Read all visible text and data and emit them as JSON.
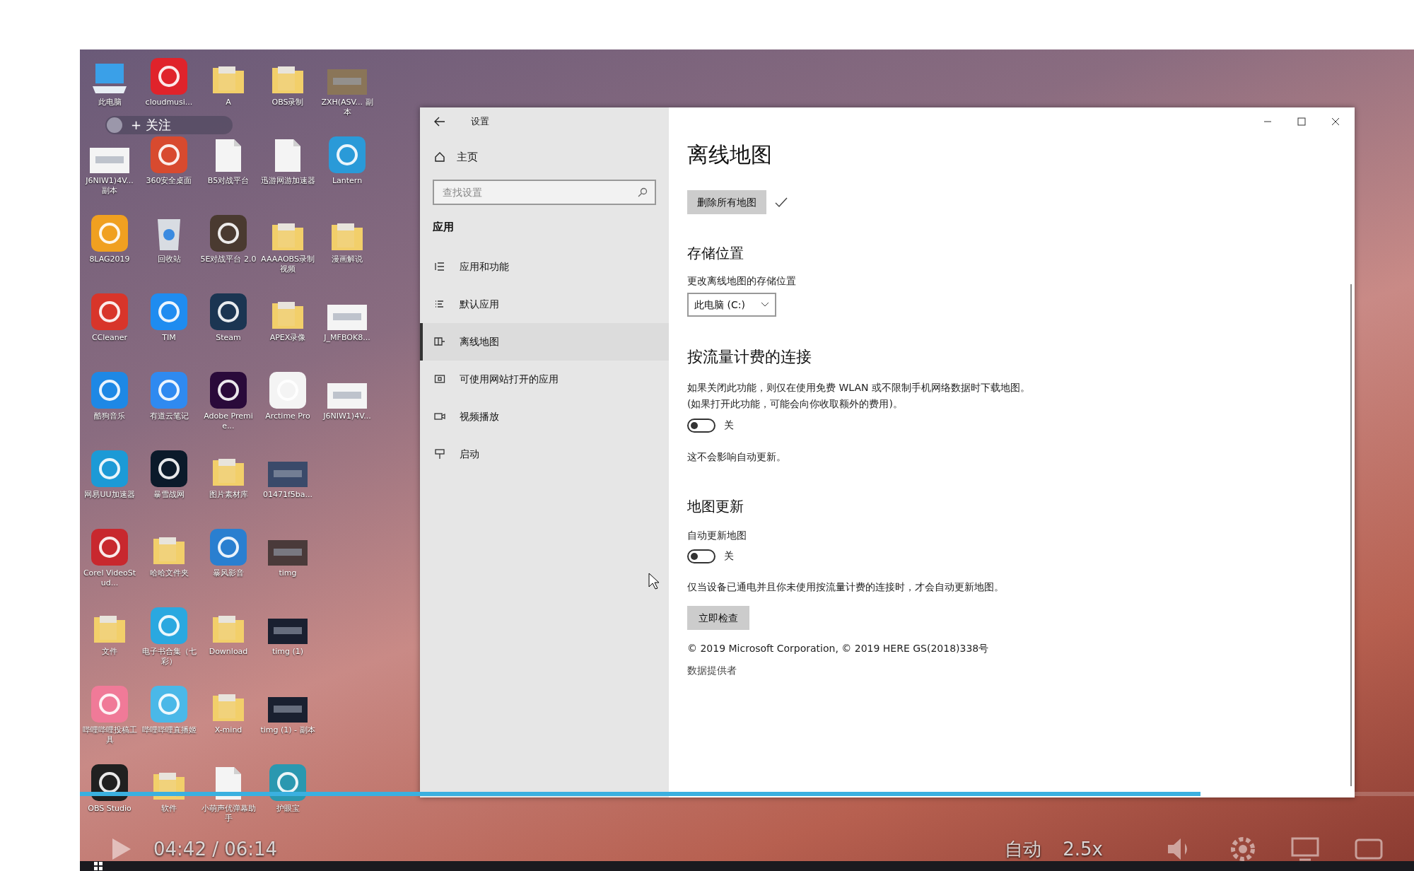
{
  "video_player": {
    "follow_button": "+ 关注",
    "time": "04:42 / 06:14",
    "quality": "自动",
    "speed": "2.5x",
    "progress": {
      "level": 0.84
    }
  },
  "desktop_icons": [
    {
      "label": "此电脑",
      "kind": "pc",
      "color": "#3aa0e8"
    },
    {
      "label": "cloudmusi...",
      "kind": "app",
      "color": "#e0232b"
    },
    {
      "label": "A",
      "kind": "folder",
      "color": "#f2cf6a"
    },
    {
      "label": "OBS录制",
      "kind": "folder",
      "color": "#f2cf6a"
    },
    {
      "label": "ZXH(ASV... 副本",
      "kind": "image",
      "color": "#8a7558"
    },
    {
      "label": "J6NIW1)4V... 副本",
      "kind": "image",
      "color": "#f4f4f4"
    },
    {
      "label": "360安全桌面",
      "kind": "app",
      "color": "#d84a2f"
    },
    {
      "label": "B5对战平台",
      "kind": "file",
      "color": "#f4f4f4"
    },
    {
      "label": "迅游网游加速器",
      "kind": "file",
      "color": "#f4f4f4"
    },
    {
      "label": "Lantern",
      "kind": "app",
      "color": "#2a9ad8"
    },
    {
      "label": "8LAG2019",
      "kind": "app",
      "color": "#f0a020"
    },
    {
      "label": "回收站",
      "kind": "bin",
      "color": "#d8dce2"
    },
    {
      "label": "5E对战平台 2.0",
      "kind": "app",
      "color": "#4a3a30"
    },
    {
      "label": "AAAAOBS录制视频",
      "kind": "folder",
      "color": "#f2cf6a"
    },
    {
      "label": "漫画解说",
      "kind": "folder",
      "color": "#f2cf6a"
    },
    {
      "label": "CCleaner",
      "kind": "app",
      "color": "#d8352a"
    },
    {
      "label": "TIM",
      "kind": "app",
      "color": "#1f8cf0"
    },
    {
      "label": "Steam",
      "kind": "app",
      "color": "#1b3552"
    },
    {
      "label": "APEX录像",
      "kind": "folder",
      "color": "#f2cf6a"
    },
    {
      "label": "J_MFBOK8...",
      "kind": "image",
      "color": "#f4f4f4"
    },
    {
      "label": "酷狗音乐",
      "kind": "app",
      "color": "#1e88e5"
    },
    {
      "label": "有道云笔记",
      "kind": "app",
      "color": "#2f8af0"
    },
    {
      "label": "Adobe Premie...",
      "kind": "app",
      "color": "#2a0a3a"
    },
    {
      "label": "Arctime Pro",
      "kind": "app",
      "color": "#f4f4f4"
    },
    {
      "label": "J6NIW1)4V...",
      "kind": "image",
      "color": "#f4f4f4"
    },
    {
      "label": "网易UU加速器",
      "kind": "app",
      "color": "#1c9ad6"
    },
    {
      "label": "暴雪战网",
      "kind": "app",
      "color": "#0b1a2a"
    },
    {
      "label": "图片素材库",
      "kind": "folder",
      "color": "#f2cf6a"
    },
    {
      "label": "01471f5ba...",
      "kind": "image",
      "color": "#3a4a6a"
    },
    {
      "label": "Corel VideoStud...",
      "kind": "app",
      "color": "#c8282e"
    },
    {
      "label": "哈哈文件夹",
      "kind": "folder",
      "color": "#f2cf6a"
    },
    {
      "label": "暴风影音",
      "kind": "app",
      "color": "#2a7fd0"
    },
    {
      "label": "timg",
      "kind": "image",
      "color": "#4a3a3a"
    },
    {
      "label": "文件",
      "kind": "folder",
      "color": "#f2cf6a"
    },
    {
      "label": "电子书合集（七彩）",
      "kind": "app",
      "color": "#2aa8e0"
    },
    {
      "label": "Download",
      "kind": "folder",
      "color": "#f2cf6a"
    },
    {
      "label": "timg (1)",
      "kind": "image",
      "color": "#1a2030"
    },
    {
      "label": "哔哩哔哩投稿工具",
      "kind": "app",
      "color": "#f07a98"
    },
    {
      "label": "哔哩哔哩直播姬",
      "kind": "app",
      "color": "#4ab8e8"
    },
    {
      "label": "X-mind",
      "kind": "folder",
      "color": "#f2cf6a"
    },
    {
      "label": "timg (1) - 副本",
      "kind": "image",
      "color": "#1a2030"
    },
    {
      "label": "OBS Studio",
      "kind": "app",
      "color": "#202020"
    },
    {
      "label": "软件",
      "kind": "folder",
      "color": "#f2cf6a"
    },
    {
      "label": "小萌声优弹幕助手",
      "kind": "file",
      "color": "#f4f4f4"
    },
    {
      "label": "护眼宝",
      "kind": "app",
      "color": "#2a98b0"
    }
  ],
  "settings": {
    "title": "设置",
    "home": "主页",
    "search": {
      "placeholder": "查找设置"
    },
    "section": "应用",
    "nav": [
      {
        "label": "应用和功能",
        "selected": false
      },
      {
        "label": "默认应用",
        "selected": false
      },
      {
        "label": "离线地图",
        "selected": true
      },
      {
        "label": "可使用网站打开的应用",
        "selected": false
      },
      {
        "label": "视频播放",
        "selected": false
      },
      {
        "label": "启动",
        "selected": false
      }
    ],
    "page_title": "离线地图",
    "delete_button": "删除所有地图",
    "storage": {
      "heading": "存储位置",
      "label": "更改离线地图的存储位置",
      "value": "此电脑 (C:)"
    },
    "metered": {
      "heading": "按流量计费的连接",
      "description": "如果关闭此功能，则仅在使用免费 WLAN 或不限制手机网络数据时下载地图。(如果打开此功能，可能会向你收取额外的费用)。",
      "toggle": {
        "on": false,
        "label": "关"
      },
      "note": "这不会影响自动更新。"
    },
    "updates": {
      "heading": "地图更新",
      "label": "自动更新地图",
      "toggle": {
        "on": false,
        "label": "关"
      },
      "note": "仅当设备已通电并且你未使用按流量计费的连接时，才会自动更新地图。",
      "button": "立即检查"
    },
    "copyright": "© 2019 Microsoft Corporation, © 2019 HERE GS(2018)338号",
    "providers": "数据提供者"
  }
}
